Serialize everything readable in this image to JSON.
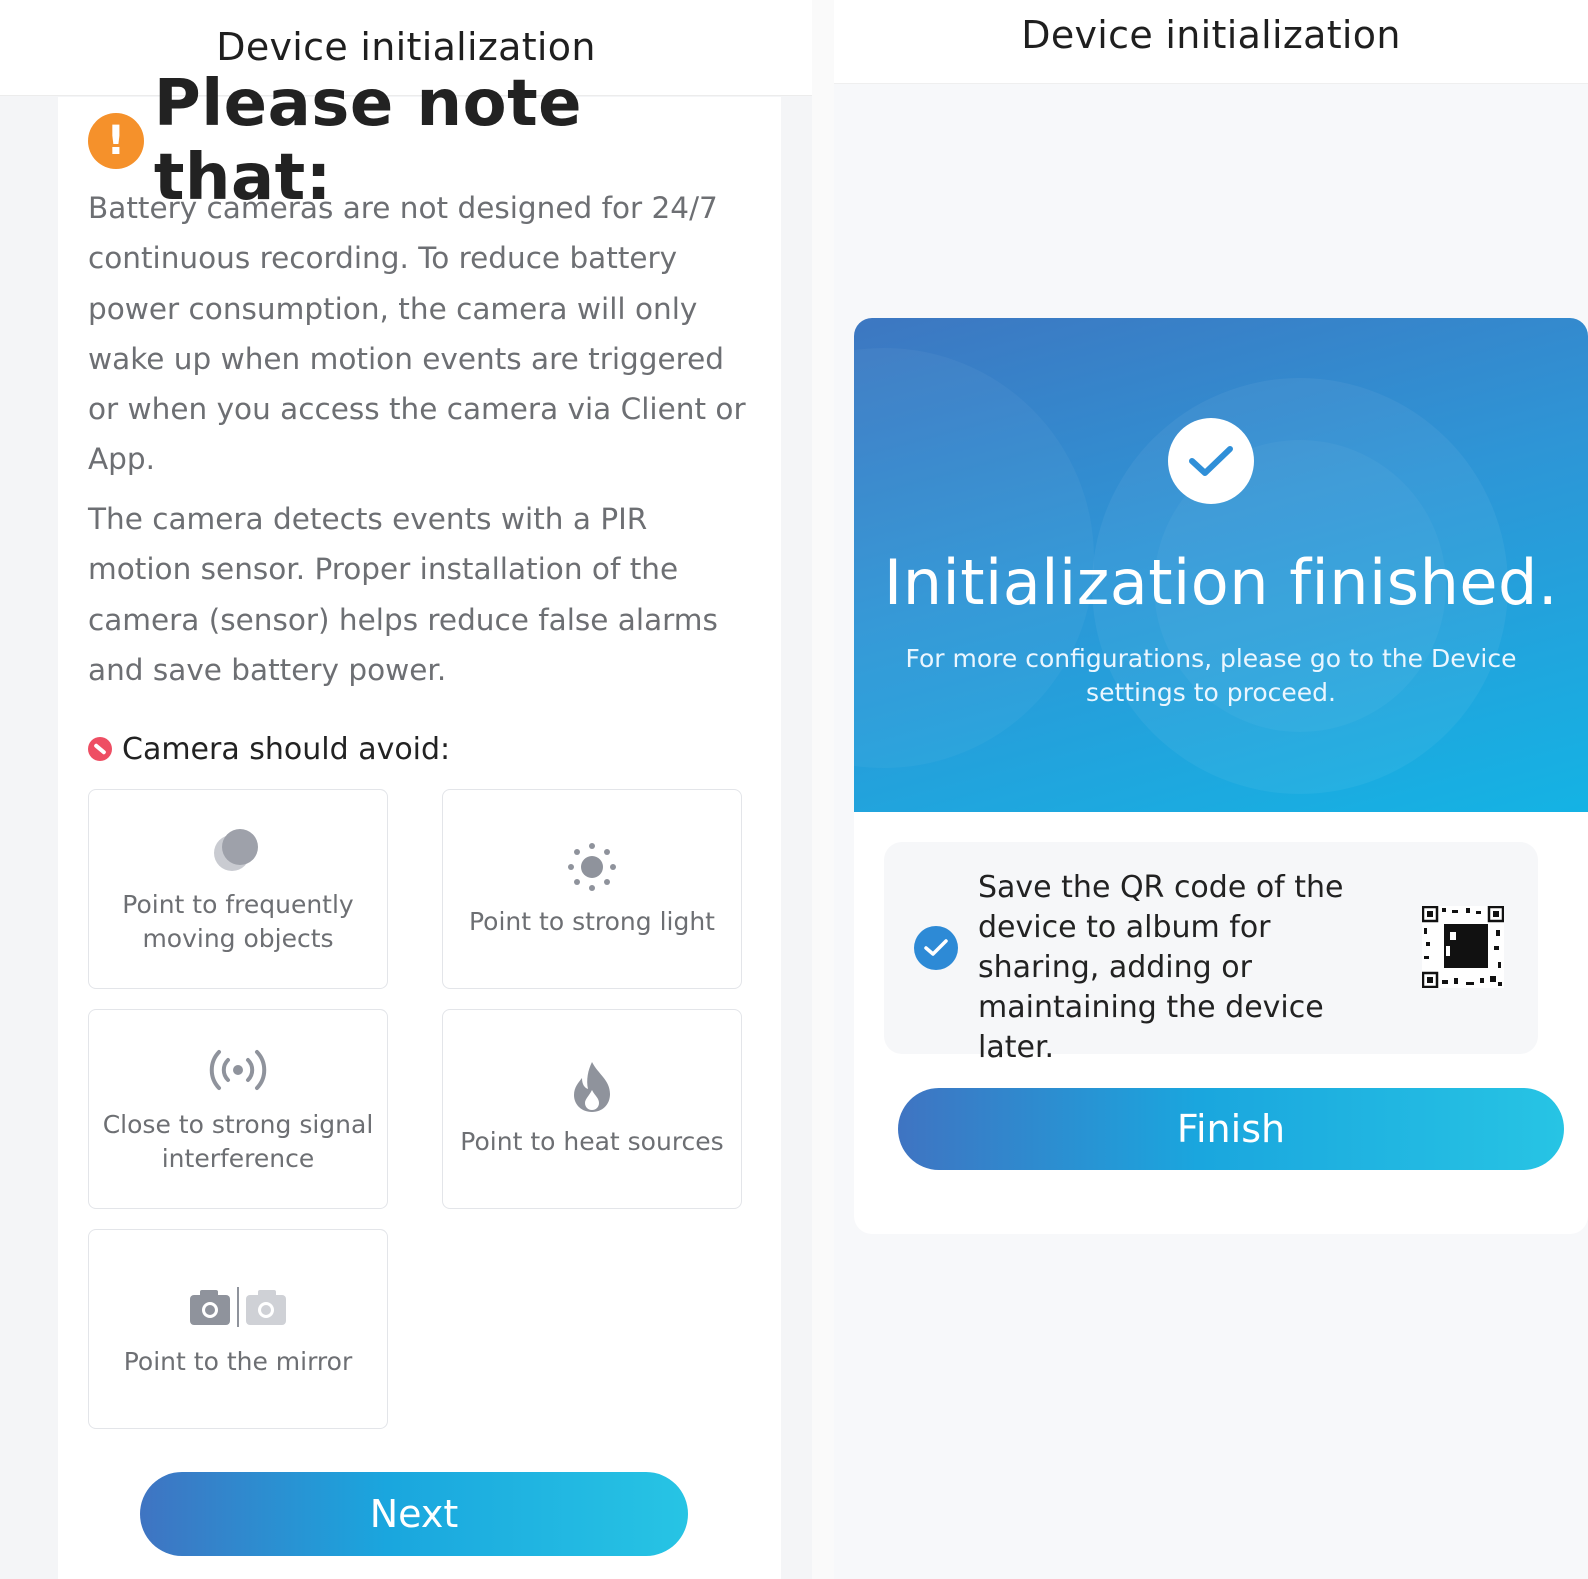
{
  "left_screen": {
    "header_title": "Device initialization",
    "note_title": "Please note that:",
    "paragraphs": [
      "Battery cameras are not designed for 24/7 continuous recording. To reduce battery power consumption, the camera will only wake up when motion events are triggered or when you access the camera via Client or App.",
      "The camera detects events with a PIR motion sensor. Proper installation of the camera (sensor) helps reduce false alarms and save battery power."
    ],
    "avoid_label": "Camera should avoid:",
    "avoid_items": [
      {
        "icon": "moving-objects-icon",
        "label": "Point to frequently moving objects"
      },
      {
        "icon": "sun-icon",
        "label": "Point to strong light"
      },
      {
        "icon": "signal-icon",
        "label": "Close to strong signal interference"
      },
      {
        "icon": "flame-icon",
        "label": "Point to heat sources"
      },
      {
        "icon": "mirror-camera-icon",
        "label": "Point to the mirror"
      }
    ],
    "next_label": "Next"
  },
  "right_screen": {
    "header_title": "Device initialization",
    "hero_title": "Initialization finished.",
    "hero_subtitle": "For more configurations, please go to the Device settings to proceed.",
    "qr_option_text": "Save the QR code of the device to album for sharing, adding or maintaining the device later.",
    "qr_option_checked": true,
    "finish_label": "Finish"
  },
  "colors": {
    "accent_orange": "#f5912b",
    "ban_red": "#ee4e63",
    "button_gradient_start": "#3f74c2",
    "button_gradient_end": "#27c4e4",
    "hero_blue": "#2e95d6"
  }
}
